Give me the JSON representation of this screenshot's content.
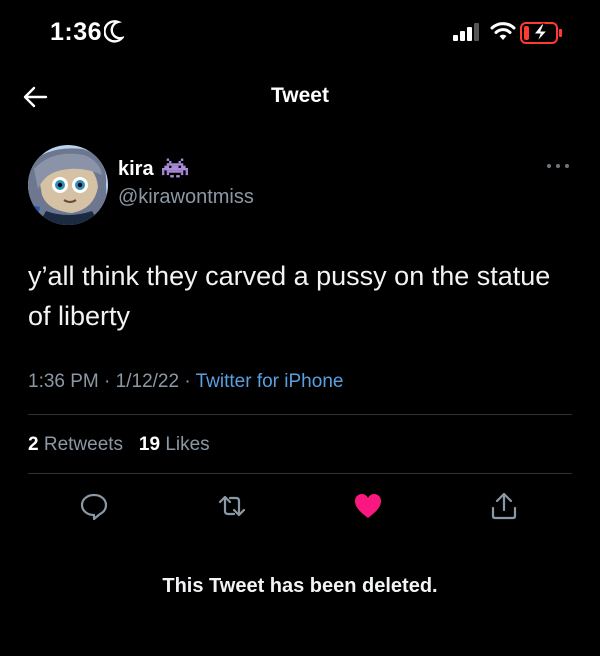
{
  "status_bar": {
    "time": "1:36",
    "icons": [
      "moon-icon",
      "signal-icon",
      "wifi-icon",
      "battery-charging-icon"
    ],
    "battery_color": "#ff3b30"
  },
  "header": {
    "back_icon": "arrow-left-icon",
    "title": "Tweet"
  },
  "tweet": {
    "author": {
      "name": "kira",
      "name_emoji_icon": "space-invader-icon",
      "handle": "@kirawontmiss"
    },
    "text": "y’all think they carved a pussy on the statue of liberty",
    "time": "1:36 PM",
    "date": "1/12/22",
    "separator": "·",
    "source": "Twitter for iPhone",
    "stats": {
      "retweets_count": "2",
      "retweets_label": "Retweets",
      "likes_count": "19",
      "likes_label": "Likes"
    },
    "actions": [
      "reply-icon",
      "retweet-icon",
      "like-icon",
      "share-icon"
    ],
    "like_color": "#f91880",
    "source_color": "#5a9fe0"
  },
  "notice": "This Tweet has been deleted."
}
